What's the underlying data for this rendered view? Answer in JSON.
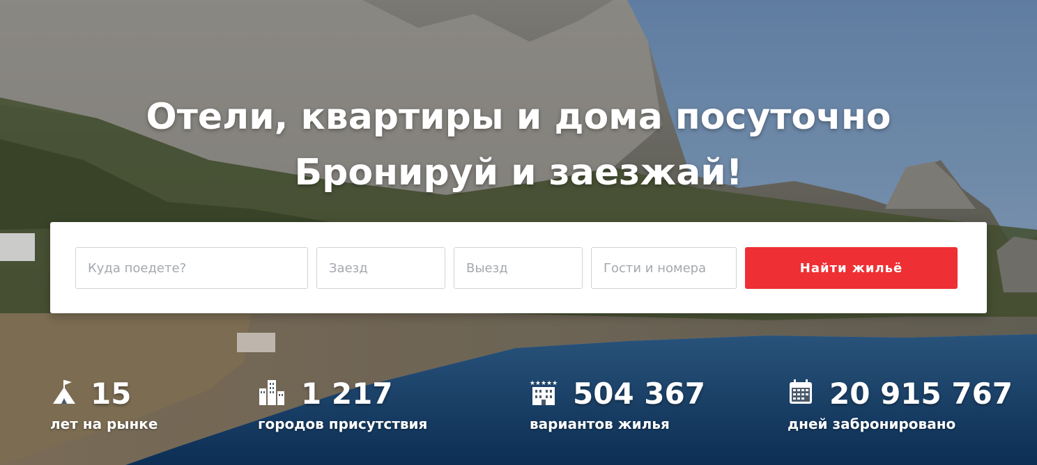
{
  "hero": {
    "headline_line1": "Отели, квартиры и дома посуточно",
    "headline_line2": "Бронируй и заезжай!"
  },
  "search": {
    "destination_placeholder": "Куда поедете?",
    "checkin_placeholder": "Заезд",
    "checkout_placeholder": "Выезд",
    "guests_placeholder": "Гости и номера",
    "submit_label": "Найти жильё",
    "submit_color": "#ee3034"
  },
  "stats": [
    {
      "value": "15",
      "label": "лет на рынке",
      "icon": "tent-flag-icon"
    },
    {
      "value": "1 217",
      "label": "городов присутствия",
      "icon": "city-buildings-icon"
    },
    {
      "value": "504 367",
      "label": "вариантов жилья",
      "icon": "hotel-stars-icon"
    },
    {
      "value": "20 915 767",
      "label": "дней забронировано",
      "icon": "calendar-icon"
    }
  ]
}
